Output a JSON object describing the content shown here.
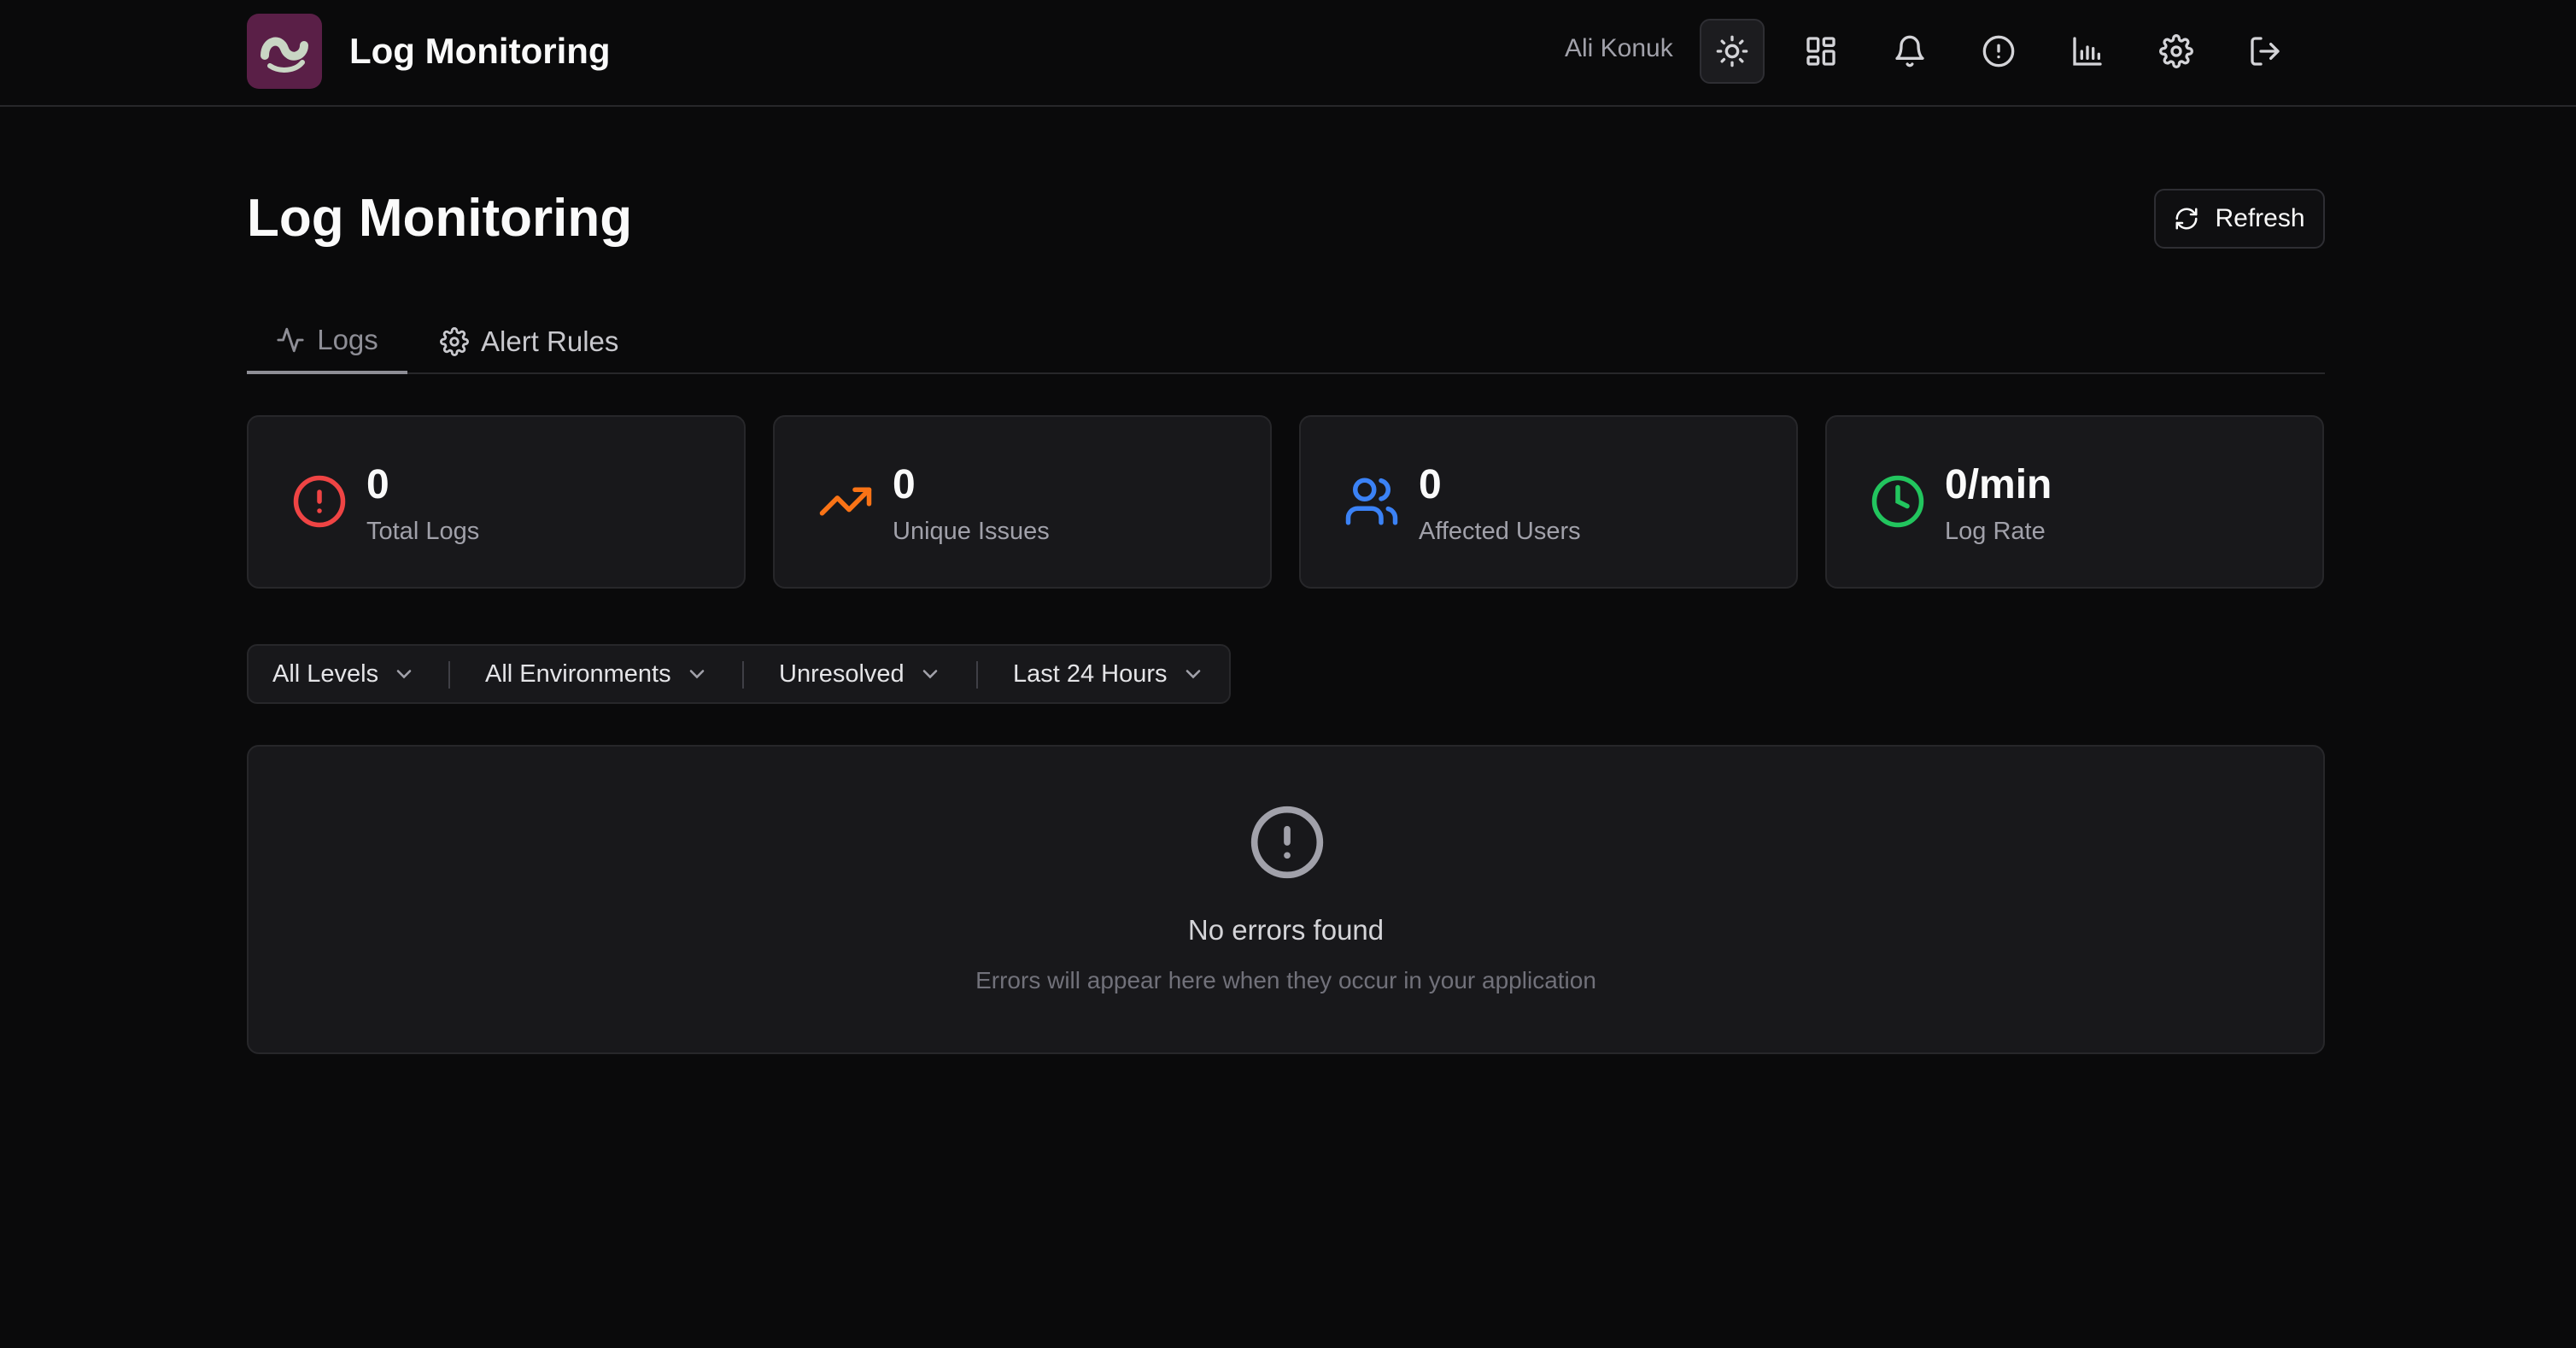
{
  "app": {
    "title": "Log Monitoring",
    "user": "Ali Konuk"
  },
  "nav": {
    "icons": [
      "sun-icon",
      "dashboard-icon",
      "bell-icon",
      "alert-circle-icon",
      "bar-chart-icon",
      "gear-icon",
      "logout-icon"
    ],
    "active": "sun-icon"
  },
  "page": {
    "title": "Log Monitoring",
    "refresh_label": "Refresh"
  },
  "tabs": [
    {
      "label": "Logs",
      "icon": "activity-icon",
      "active": true
    },
    {
      "label": "Alert Rules",
      "icon": "gear-icon",
      "active": false
    }
  ],
  "stats": [
    {
      "value": "0",
      "label": "Total Logs",
      "icon": "alert-circle-icon",
      "color": "#ef4444"
    },
    {
      "value": "0",
      "label": "Unique Issues",
      "icon": "trending-up-icon",
      "color": "#f97316"
    },
    {
      "value": "0",
      "label": "Affected Users",
      "icon": "users-icon",
      "color": "#3b82f6"
    },
    {
      "value": "0/min",
      "label": "Log Rate",
      "icon": "clock-icon",
      "color": "#22c55e"
    }
  ],
  "filters": [
    {
      "label": "All Levels"
    },
    {
      "label": "All Environments"
    },
    {
      "label": "Unresolved"
    },
    {
      "label": "Last 24 Hours"
    }
  ],
  "empty_state": {
    "title": "No errors found",
    "subtitle": "Errors will appear here when they occur in your application",
    "icon": "alert-circle-icon"
  },
  "colors": {
    "background": "#0a0a0b",
    "card": "#18181b",
    "border": "#27272a",
    "logo_bg": "#5a1f47"
  }
}
